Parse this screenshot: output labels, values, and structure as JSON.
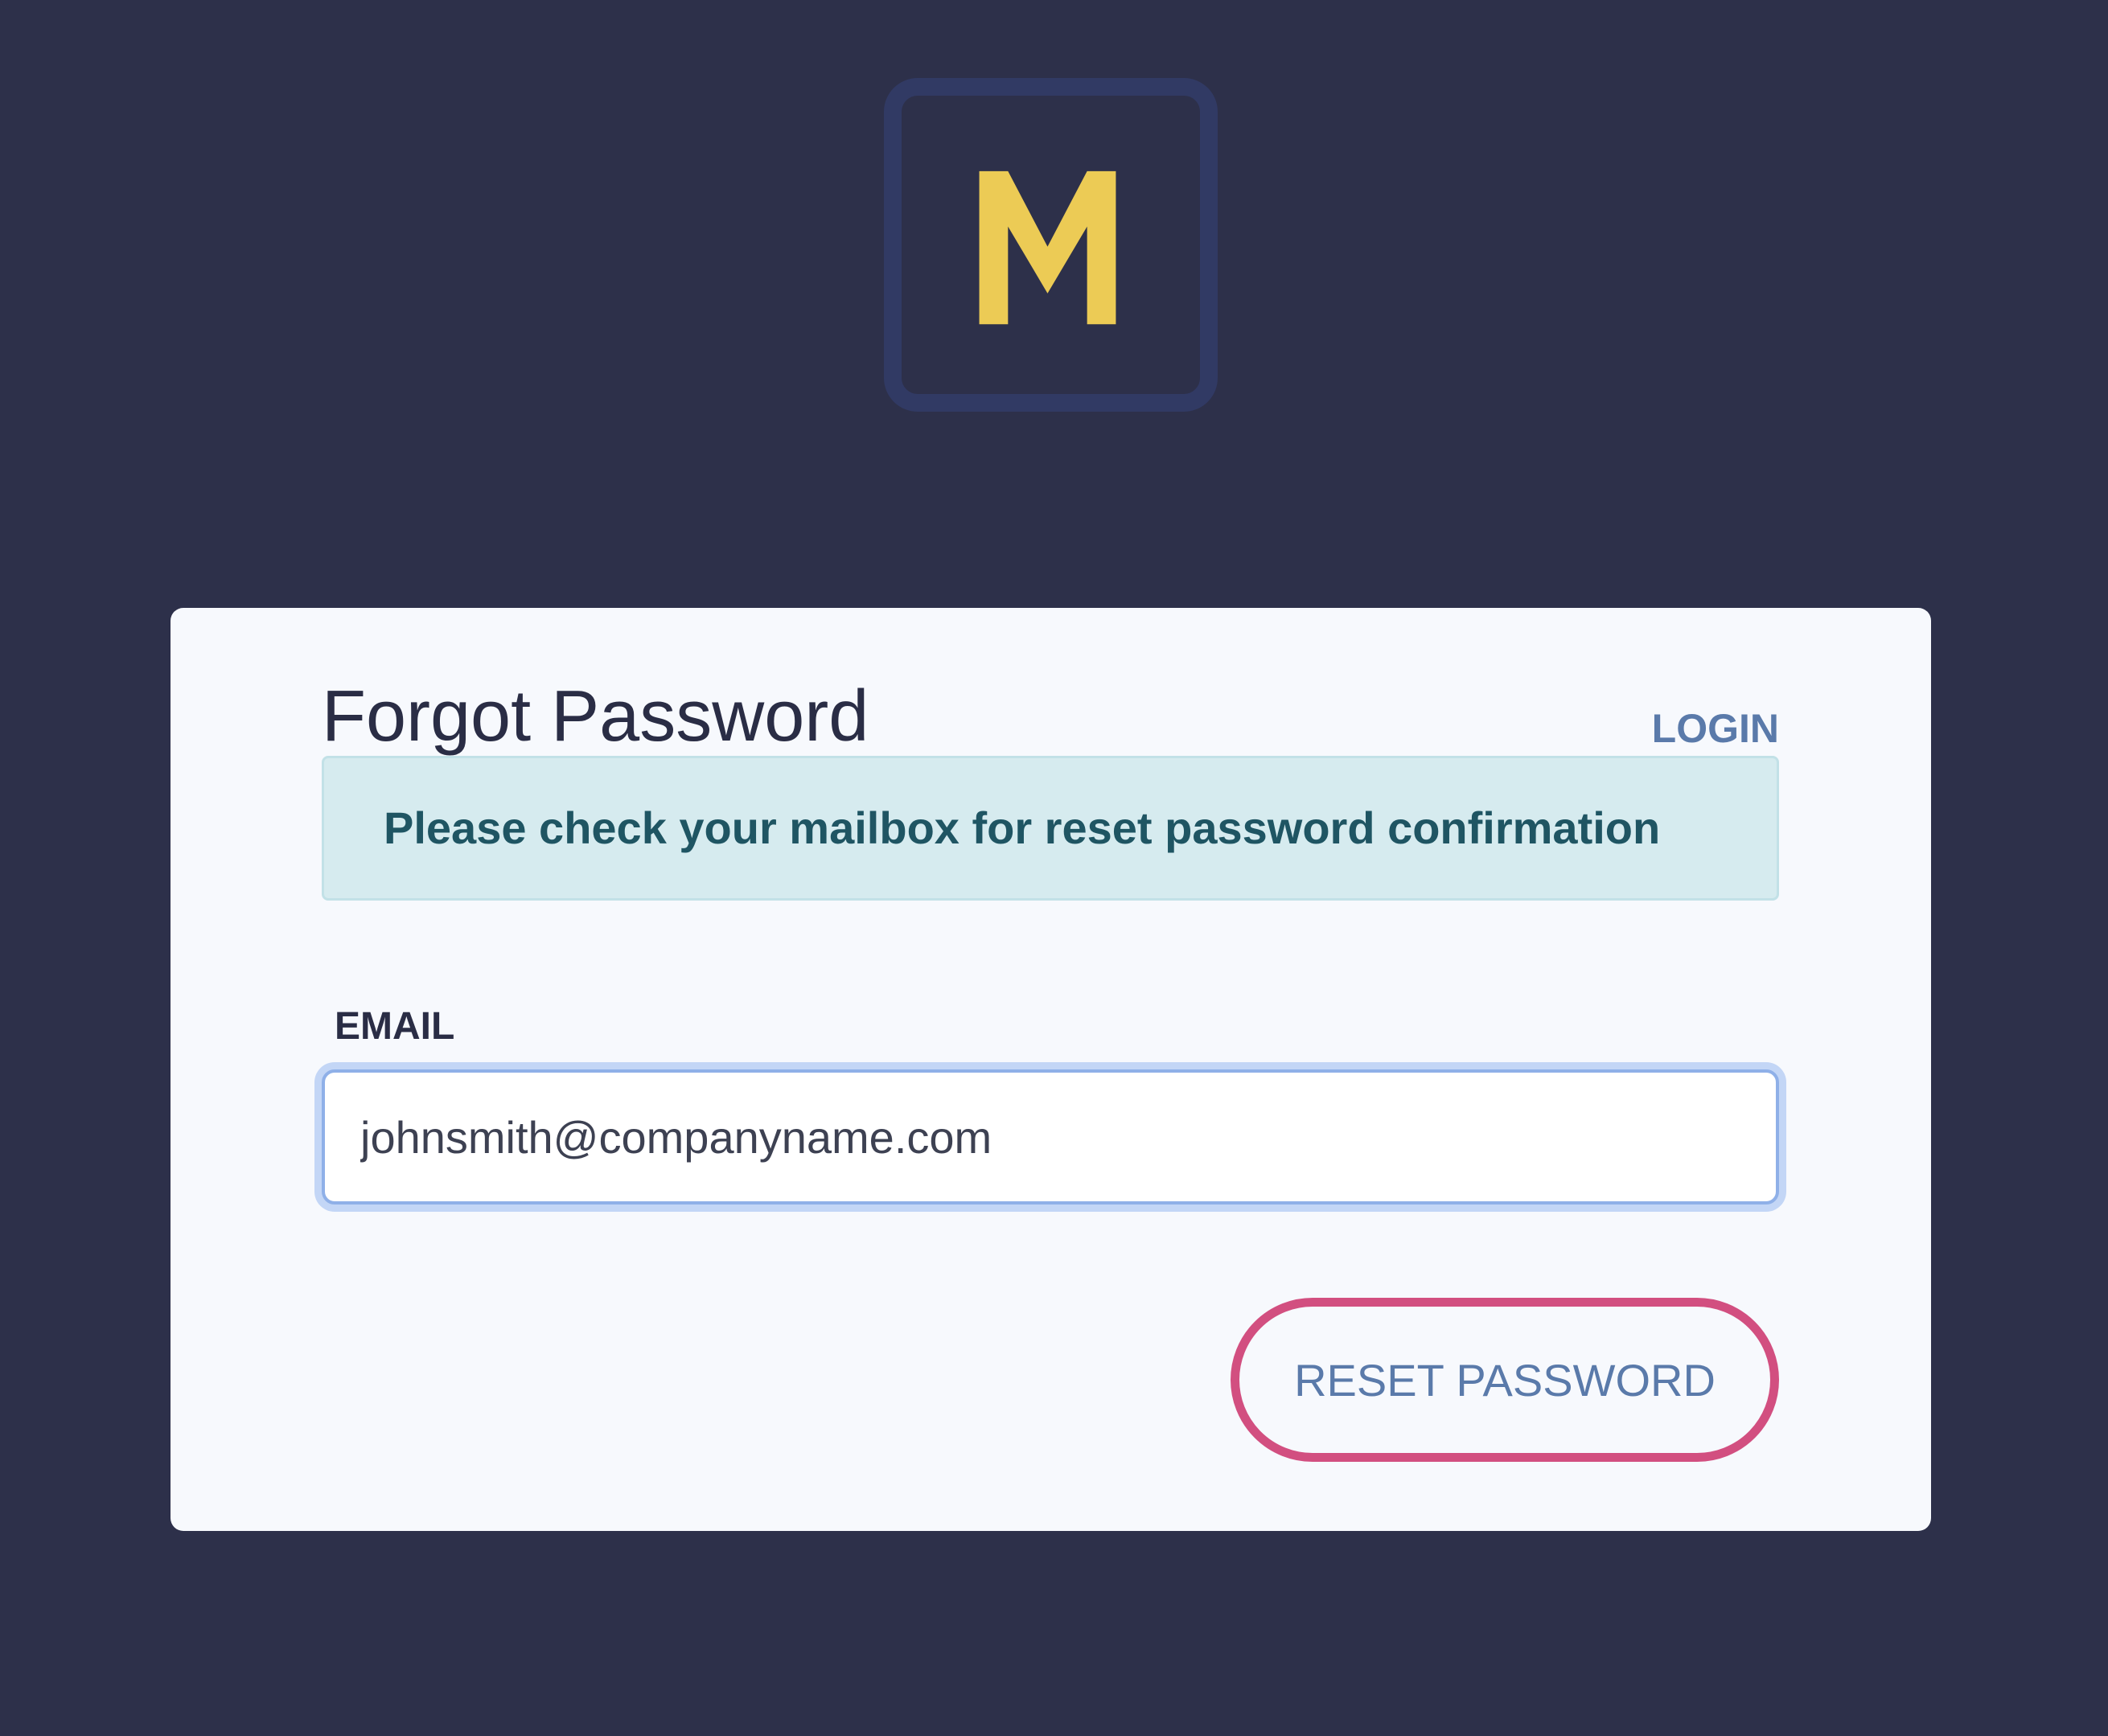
{
  "logo": {
    "letter": "M",
    "icon": "m-logo-icon",
    "letter_color": "#eccb55",
    "frame_color": "#313a64"
  },
  "card": {
    "title": "Forgot Password",
    "login_link": "LOGIN",
    "alert": {
      "message": "Please check your mailbox for reset password confirmation"
    },
    "email": {
      "label": "EMAIL",
      "value": "johnsmith@companyname.com"
    },
    "reset_button": "RESET PASSWORD"
  },
  "colors": {
    "background": "#2d304a",
    "card": "#f7f9fd",
    "accent_link": "#5a7aaa",
    "highlight_ring": "#d24f80",
    "alert_bg": "#d6ebef",
    "alert_text": "#1f5563"
  }
}
